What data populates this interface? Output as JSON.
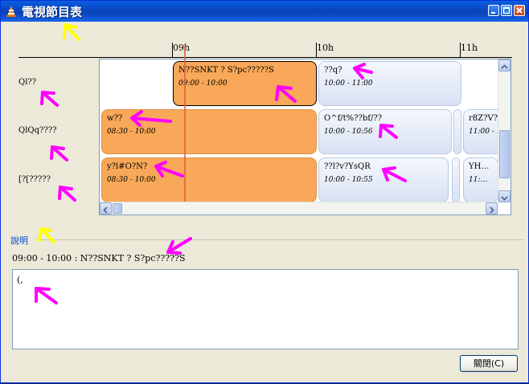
{
  "window": {
    "title": "電視節目表",
    "icon": "vlc-cone-icon"
  },
  "timeline": {
    "labels": [
      "09h",
      "10h",
      "11h"
    ]
  },
  "channels": [
    {
      "name": "Ql??"
    },
    {
      "name": "QlQq????"
    },
    {
      "name": "[?[?????"
    }
  ],
  "programs": [
    {
      "channel": 0,
      "name": "N??SNKT ? S?pc?????S",
      "time": "09:00 - 10:00",
      "color": "orange",
      "selected": true
    },
    {
      "channel": 0,
      "name": "??q?",
      "time": "10:00 - 11:00",
      "color": "blue"
    },
    {
      "channel": 1,
      "name": "w??",
      "time": "08:30 - 10:00",
      "color": "orange"
    },
    {
      "channel": 1,
      "name": "O^f/t%??bf/??",
      "time": "10:00 - 10:56",
      "color": "blue"
    },
    {
      "channel": 1,
      "name": "",
      "time": "",
      "color": "blue"
    },
    {
      "channel": 1,
      "name": "r8Z?V?_",
      "time": "11:00 - 1",
      "color": "blue"
    },
    {
      "channel": 2,
      "name": "y?l#O?N?",
      "time": "08:30 - 10:00",
      "color": "orange"
    },
    {
      "channel": 2,
      "name": "??l?v?YsQR",
      "time": "10:00 - 10:55",
      "color": "blue"
    },
    {
      "channel": 2,
      "name": "",
      "time": "",
      "color": "blue"
    },
    {
      "channel": 2,
      "name": "YH…",
      "time": "11:…",
      "color": "blue"
    }
  ],
  "description": {
    "section_label": "說明",
    "summary": "09:00 - 10:00 : N??SNKT ? S?pc?????S",
    "text": "(,"
  },
  "buttons": {
    "close_label": "關閉(C)"
  },
  "colors": {
    "orange": "#f8a858",
    "blue": "#d8e2f4",
    "annotation_magenta": "#ff00ff",
    "annotation_yellow": "#ffff00"
  }
}
